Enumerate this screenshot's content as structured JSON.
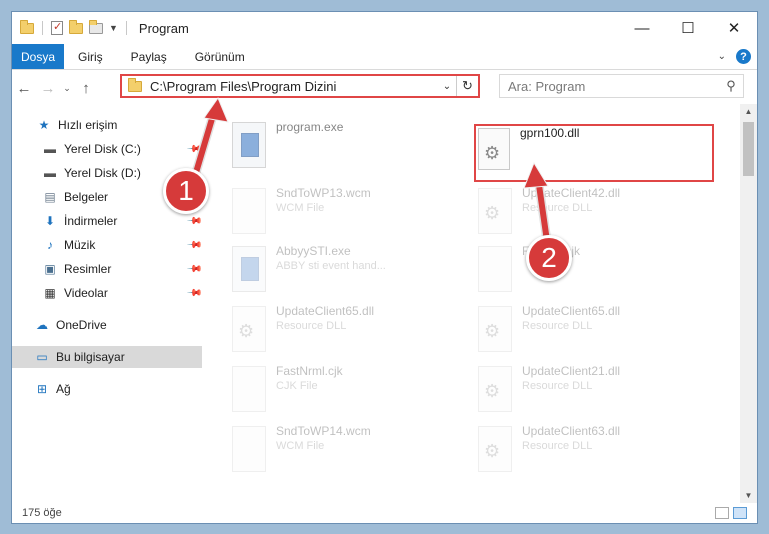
{
  "window": {
    "title": "Program"
  },
  "ribbon": {
    "tabs": [
      "Dosya",
      "Giriş",
      "Paylaş",
      "Görünüm"
    ],
    "help_icon": "?"
  },
  "controls": {
    "minimize": "—",
    "maximize": "☐",
    "close": "✕"
  },
  "nav": {
    "address": "C:\\Program Files\\Program Dizini",
    "search_placeholder": "Ara: Program"
  },
  "sidebar": {
    "items": [
      {
        "label": "Hızlı erişim",
        "icon": "star-icon",
        "pinned": false
      },
      {
        "label": "Yerel Disk (C:)",
        "icon": "drive-icon",
        "pinned": true
      },
      {
        "label": "Yerel Disk (D:)",
        "icon": "drive-icon",
        "pinned": true
      },
      {
        "label": "Belgeler",
        "icon": "documents-icon",
        "pinned": true
      },
      {
        "label": "İndirmeler",
        "icon": "download-icon",
        "pinned": true
      },
      {
        "label": "Müzik",
        "icon": "music-icon",
        "pinned": true
      },
      {
        "label": "Resimler",
        "icon": "pictures-icon",
        "pinned": true
      },
      {
        "label": "Videolar",
        "icon": "videos-icon",
        "pinned": true
      },
      {
        "label": "OneDrive",
        "icon": "cloud-icon",
        "pinned": false
      },
      {
        "label": "Bu bilgisayar",
        "icon": "computer-icon",
        "pinned": false
      },
      {
        "label": "Ağ",
        "icon": "network-icon",
        "pinned": false
      }
    ]
  },
  "files": [
    {
      "name": "program.exe",
      "type": "",
      "icon": "exe-icon"
    },
    {
      "name": "gprn100.dll",
      "type": "",
      "icon": "dll-icon"
    },
    {
      "name": "SndToWP13.wcm",
      "type": "WCM File",
      "icon": "file-icon"
    },
    {
      "name": "UpdateClient42.dll",
      "type": "Resource DLL",
      "icon": "dll-icon"
    },
    {
      "name": "AbbyySTI.exe",
      "type": "ABBY sti event hand...",
      "icon": "exe-icon"
    },
    {
      "name": "FmNrm.cjk",
      "type": "",
      "icon": "file-icon"
    },
    {
      "name": "UpdateClient65.dll",
      "type": "Resource DLL",
      "icon": "dll-icon"
    },
    {
      "name": "UpdateClient65.dll",
      "type": "Resource DLL",
      "icon": "dll-icon"
    },
    {
      "name": "FastNrml.cjk",
      "type": "CJK File",
      "icon": "file-icon"
    },
    {
      "name": "UpdateClient21.dll",
      "type": "Resource DLL",
      "icon": "dll-icon"
    },
    {
      "name": "SndToWP14.wcm",
      "type": "WCM File",
      "icon": "file-icon"
    },
    {
      "name": "UpdateClient63.dll",
      "type": "Resource DLL",
      "icon": "dll-icon"
    }
  ],
  "status": {
    "count": "175 öğe"
  },
  "annotations": {
    "step1": "1",
    "step2": "2"
  },
  "colors": {
    "accent": "#1979ca",
    "annotation": "#d63a3a",
    "highlight_border": "#e04646"
  }
}
